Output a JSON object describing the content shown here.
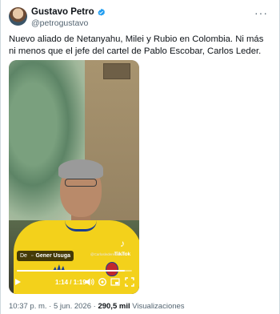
{
  "author": {
    "name": "Gustavo Petro",
    "handle": "@petrogustavo",
    "verified_color": "#1d9bf0"
  },
  "tweet": {
    "text": "Nuevo aliado de Netanyahu, Milei y Rubio en Colombia. Ni más ni menos que el jefe del cartel de Pablo Escobar, Carlos Leder."
  },
  "video": {
    "credit_from": "De",
    "credit_separator": "⬜",
    "credit_name": "Gener Usuga",
    "watermark_brand": "TikTok",
    "watermark_user": "@Carlosledereloficial",
    "elapsed": "1:14",
    "duration": "1:19",
    "progress": 0.94
  },
  "meta": {
    "time": "10:37 p. m.",
    "dot1": "·",
    "date": "5 jun. 2026",
    "dot2": "·",
    "views_count": "290,5 mil",
    "views_label": "Visualizaciones"
  },
  "icons": {
    "more": "more-options-icon",
    "play": "play-icon",
    "volume": "volume-icon",
    "settings": "settings-icon",
    "pip": "picture-in-picture-icon",
    "fullscreen": "fullscreen-icon"
  }
}
